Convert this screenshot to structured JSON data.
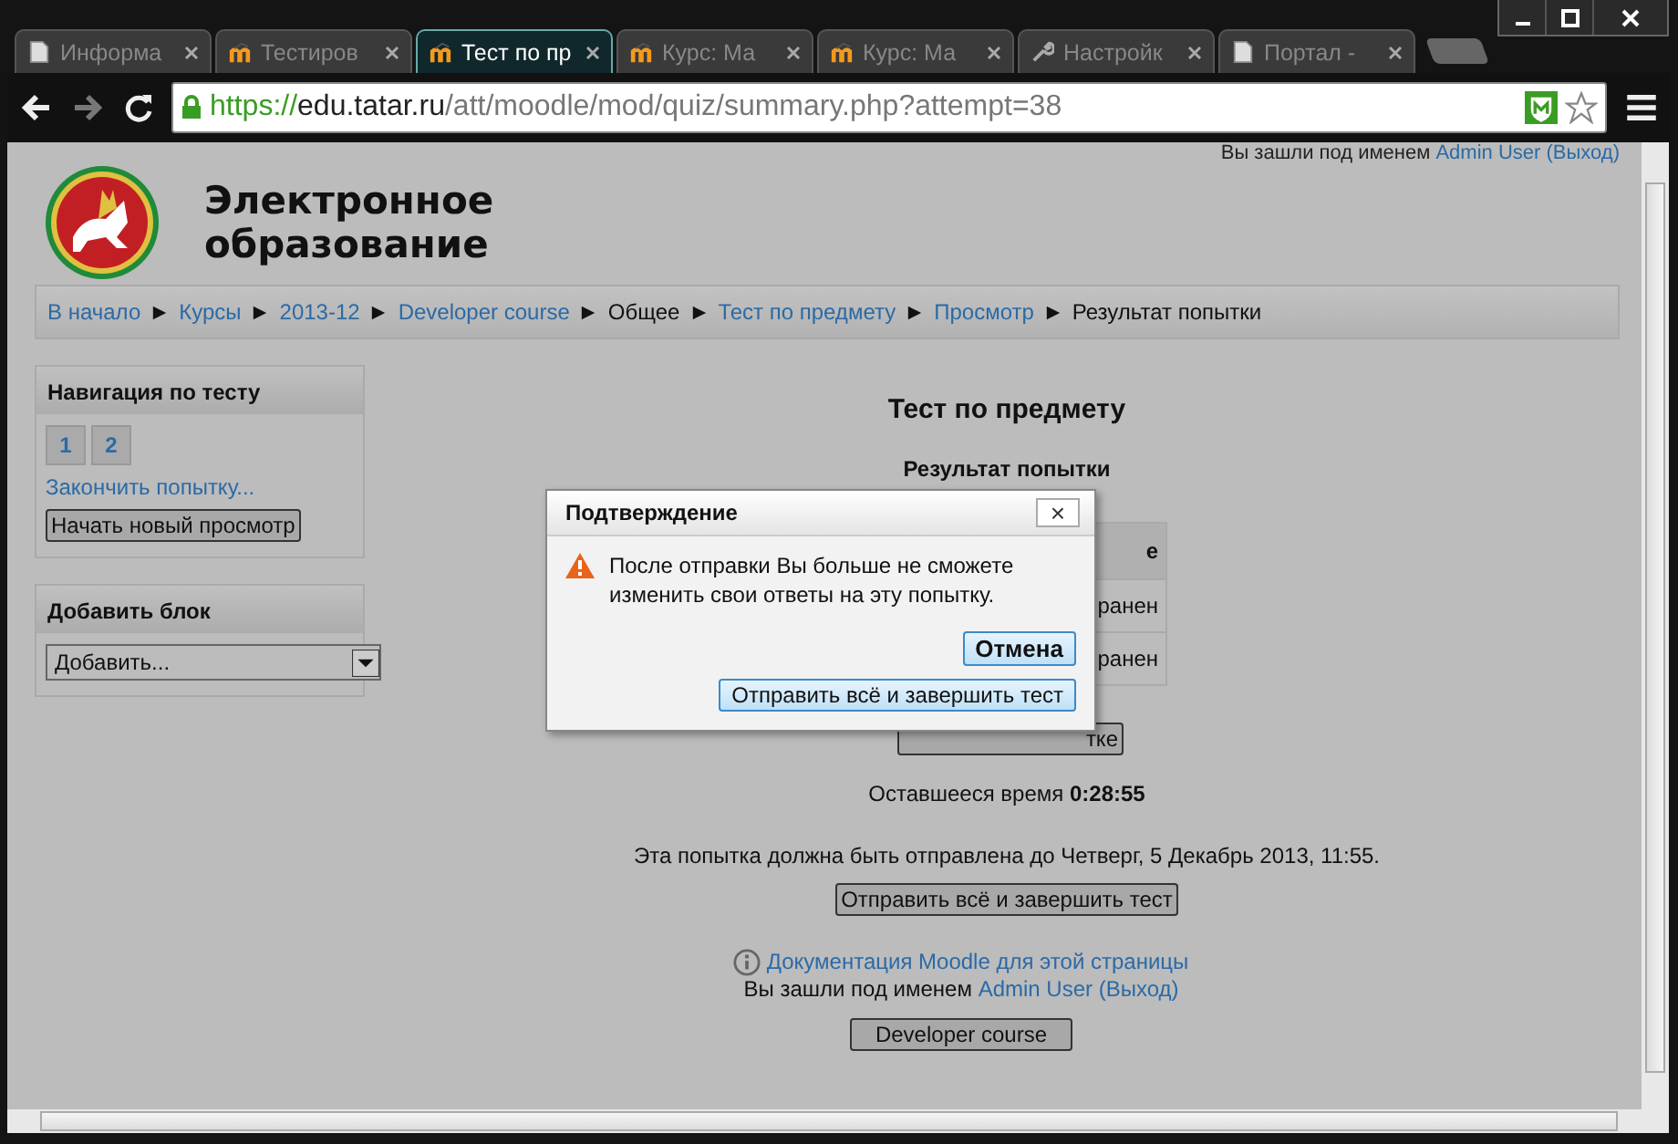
{
  "browser": {
    "tabs": [
      {
        "label": "Информа",
        "kind": "page",
        "selected": false
      },
      {
        "label": "Тестиров",
        "kind": "moodle",
        "selected": false
      },
      {
        "label": "Тест по пр",
        "kind": "moodle",
        "selected": true
      },
      {
        "label": "Курс: Ма",
        "kind": "moodle",
        "selected": false
      },
      {
        "label": "Курс: Ма",
        "kind": "moodle",
        "selected": false
      },
      {
        "label": "Настройк",
        "kind": "settings",
        "selected": false
      },
      {
        "label": "Портал -",
        "kind": "page",
        "selected": false
      }
    ],
    "url": {
      "scheme": "https://",
      "host": "edu.tatar.ru",
      "path": "/att/moodle/mod/quiz/summary.php?attempt=38"
    }
  },
  "header": {
    "login_text": "Вы зашли под именем",
    "login_user": "Admin User",
    "login_logout": "(Выход)",
    "site_title": [
      "Электронное",
      "образование"
    ]
  },
  "breadcrumb": [
    {
      "label": "В начало",
      "link": true
    },
    {
      "label": "Курсы",
      "link": true
    },
    {
      "label": "2013-12",
      "link": true
    },
    {
      "label": "Developer course",
      "link": true
    },
    {
      "label": "Общее",
      "link": false
    },
    {
      "label": "Тест по предмету",
      "link": true
    },
    {
      "label": "Просмотр",
      "link": true
    },
    {
      "label": "Результат попытки",
      "link": false
    }
  ],
  "quiz_navigation": {
    "title": "Навигация по тесту",
    "questions": [
      "1",
      "2"
    ],
    "finish_link": "Закончить попытку...",
    "new_preview_button": "Начать новый просмотр"
  },
  "add_block": {
    "title": "Добавить блок",
    "select_value": "Добавить..."
  },
  "main": {
    "title": "Тест по предмету",
    "subtitle": "Результат попытки",
    "table": {
      "header": "е",
      "rows": [
        "ранен",
        "ранен"
      ]
    },
    "return_button": "тке",
    "time_label": "Оставшееся время",
    "time_value": "0:28:55",
    "deadline": "Эта попытка должна быть отправлена до Четверг, 5 Декабрь 2013, 11:55.",
    "submit_button": "Отправить всё и завершить тест"
  },
  "footer": {
    "docs_link": "Документация Moodle для этой страницы",
    "login_text": "Вы зашли под именем",
    "login_user": "Admin User",
    "login_logout": "(Выход)",
    "course_button": "Developer course"
  },
  "dialog": {
    "title": "Подтверждение",
    "close": "×",
    "message": "После отправки Вы больше не сможете изменить свои ответы на эту попытку.",
    "cancel_button": "Отмена",
    "submit_button": "Отправить всё и завершить тест"
  }
}
